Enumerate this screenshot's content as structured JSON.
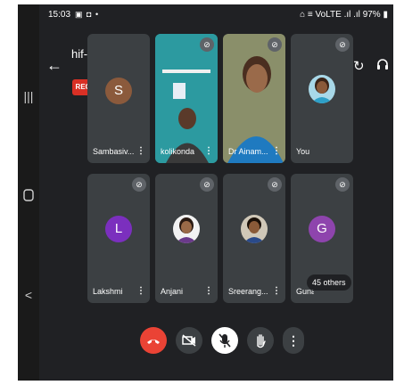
{
  "status_bar": {
    "time": "15:03",
    "left_icons": "▣ ◘ •",
    "right_icons": "⌂ ≡ VoLTE .ıl .ıl",
    "battery": "97%"
  },
  "meeting": {
    "title": "hif-drgt-ftv",
    "title_caret": "▸",
    "rec_label": "REC"
  },
  "icons": {
    "back": "←",
    "speaker_switch": "↻",
    "audio": "∩",
    "mic_off": "⊘",
    "more": "⋮"
  },
  "participants": [
    {
      "name": "Sambasiv...",
      "avatar_letter": "S",
      "avatar_color": "#8b5a3c",
      "video": false
    },
    {
      "name": "kolikonda",
      "video": true
    },
    {
      "name": "Dr Ainam...",
      "video": true
    },
    {
      "name": "You",
      "video": false
    },
    {
      "name": "Lakshmi",
      "avatar_letter": "L",
      "avatar_color": "#7b2fbe",
      "muted": true
    },
    {
      "name": "Anjani",
      "muted": true
    },
    {
      "name": "Sreerang...",
      "muted": true
    },
    {
      "name": "Guna",
      "avatar_letter": "G",
      "avatar_color": "#8e44ad",
      "muted": true
    }
  ],
  "others_count_label": "45 others",
  "controls": {
    "end_call": "end-call",
    "camera": "camera-off",
    "mic": "mic-off",
    "hand": "raise-hand",
    "more": "more-options"
  },
  "colors": {
    "background": "#202124",
    "tile": "#3c4043",
    "end_call": "#ea4335",
    "rec": "#d93025"
  }
}
